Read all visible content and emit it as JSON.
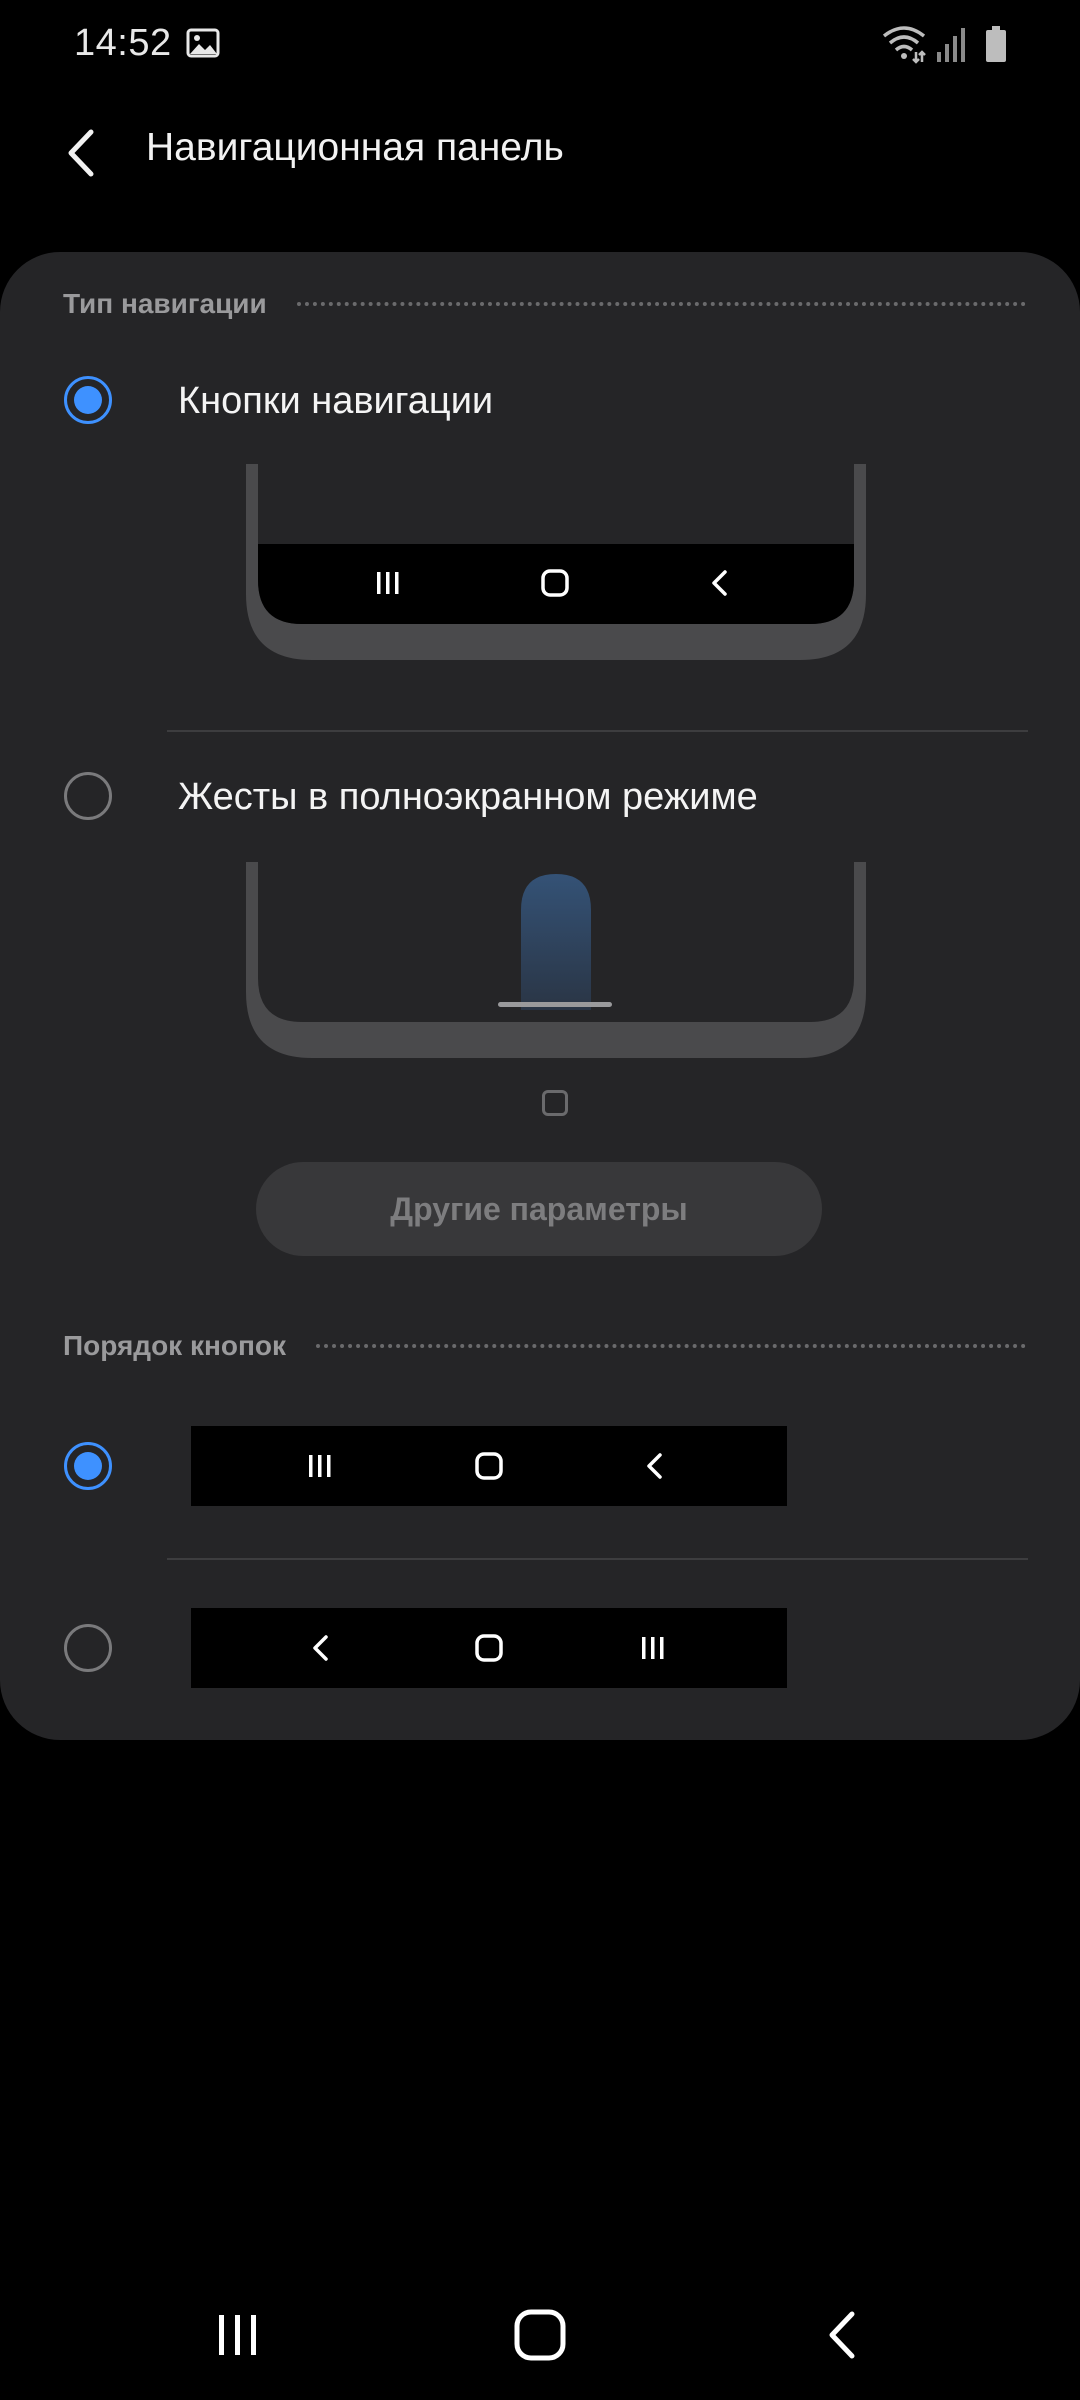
{
  "status_bar": {
    "time": "14:52",
    "icons": [
      "gallery-icon",
      "wifi-icon",
      "signal-icon",
      "battery-icon"
    ]
  },
  "app_bar": {
    "title": "Навигационная панель",
    "back_icon": "chevron-left-icon"
  },
  "navigation_type": {
    "header": "Тип навигации",
    "options": [
      {
        "label": "Кнопки навигации",
        "selected": true
      },
      {
        "label": "Жесты в полноэкранном режиме",
        "selected": false
      }
    ],
    "other_params_label": "Другие параметры"
  },
  "button_order": {
    "header": "Порядок кнопок",
    "options": [
      {
        "order": [
          "recents",
          "home",
          "back"
        ],
        "selected": true
      },
      {
        "order": [
          "back",
          "home",
          "recents"
        ],
        "selected": false
      }
    ]
  },
  "colors": {
    "accent": "#3e91ff",
    "card_background": "#252527",
    "screen_background": "#000000"
  }
}
